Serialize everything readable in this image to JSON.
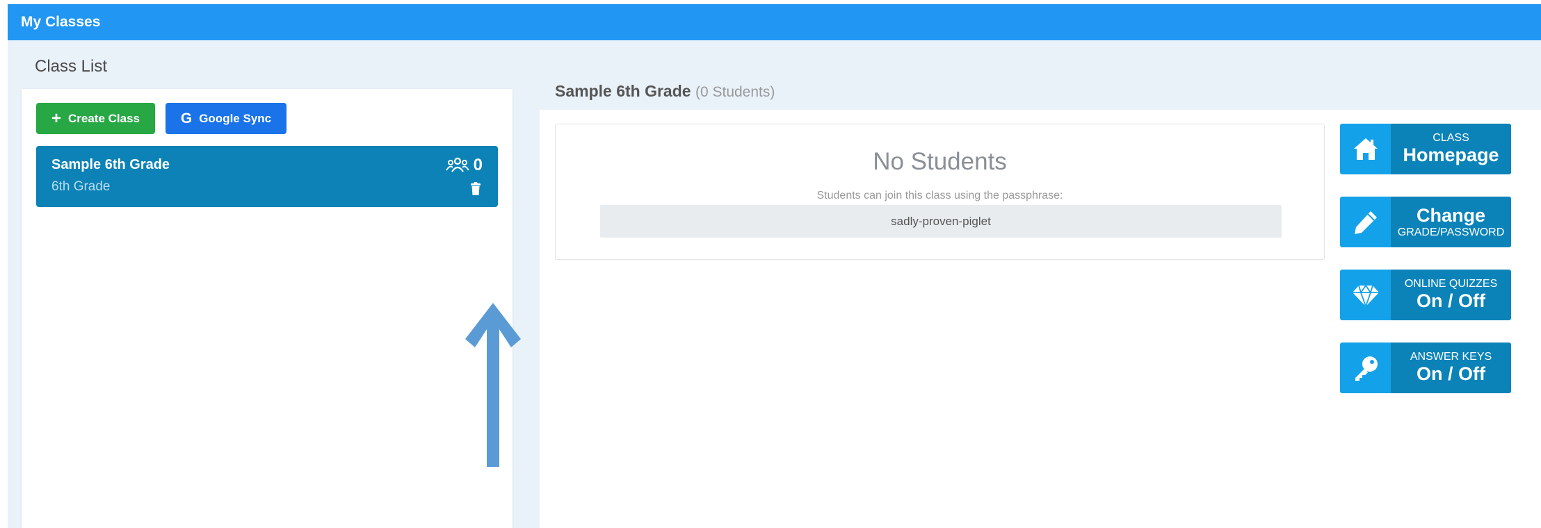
{
  "header": {
    "title": "My Classes"
  },
  "class_list": {
    "title": "Class List",
    "create_label": "Create Class",
    "google_label": "Google Sync",
    "google_mark": "G",
    "classes": [
      {
        "name": "Sample 6th Grade",
        "grade": "6th Grade",
        "student_count": "0"
      }
    ]
  },
  "main": {
    "class_title": "Sample 6th Grade",
    "student_count_text": "(0 Students)",
    "no_students": "No Students",
    "passphrase_hint": "Students can join this class using the passphrase:",
    "passphrase": "sadly-proven-piglet"
  },
  "actions": [
    {
      "small": "CLASS",
      "big": "Homepage",
      "icon": "home-icon"
    },
    {
      "big": "Change",
      "small": "GRADE/PASSWORD",
      "icon": "pencil-icon"
    },
    {
      "small": "ONLINE QUIZZES",
      "big": "On / Off",
      "icon": "diamond-icon"
    },
    {
      "small": "ANSWER KEYS",
      "big": "On / Off",
      "icon": "key-icon"
    }
  ],
  "colors": {
    "header": "#2196f3",
    "create_button": "#28a745",
    "google_button": "#1a73e8",
    "class_card": "#0c82b6",
    "action_icon_bg": "#13a2e9",
    "action_label_bg": "#0b83b8",
    "annotation_arrow": "#5b9bd5"
  }
}
